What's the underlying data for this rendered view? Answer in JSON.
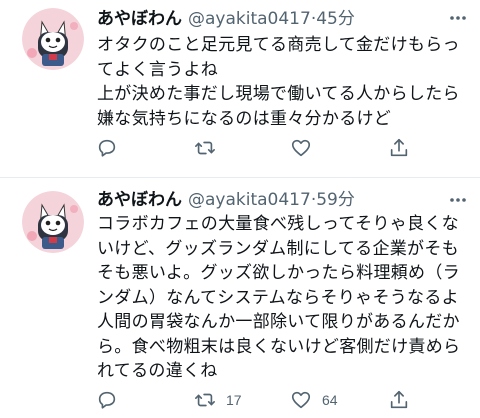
{
  "tweets": [
    {
      "display_name": "あやぼわん",
      "handle": "@ayakita0417",
      "separator": "·",
      "time": "45分",
      "body_lines": [
        "オタクのこと足元見てる商売して金だけもらっ",
        "てよく言うよね",
        "上が決めた事だし現場で働いてる人からしたら",
        "嫌な気持ちになるのは重々分かるけど"
      ],
      "reply_count": "",
      "retweet_count": "",
      "like_count": "",
      "icons": {
        "reply": "reply-icon",
        "retweet": "retweet-icon",
        "like": "heart-icon",
        "share": "share-icon",
        "more": "more-icon"
      }
    },
    {
      "display_name": "あやぼわん",
      "handle": "@ayakita0417",
      "separator": "·",
      "time": "59分",
      "body_lines": [
        "コラボカフェの大量食べ残しってそりゃ良くな",
        "いけど、グッズランダム制にしてる企業がそも",
        "そも悪いよ。グッズ欲しかったら料理頼め（ラ",
        "ンダム）なんてシステムならそりゃそうなるよ",
        "人間の胃袋なんか一部除いて限りがあるんだか",
        "ら。食べ物粗末は良くないけど客側だけ責めら",
        "れてるの違くね"
      ],
      "reply_count": "",
      "retweet_count": "17",
      "like_count": "64",
      "icons": {
        "reply": "reply-icon",
        "retweet": "retweet-icon",
        "like": "heart-icon",
        "share": "share-icon",
        "more": "more-icon"
      }
    }
  ],
  "colors": {
    "text": "#0f1419",
    "secondary": "#536471",
    "divider": "#e6ecf0",
    "avatar_bg": "#f4d4da"
  }
}
